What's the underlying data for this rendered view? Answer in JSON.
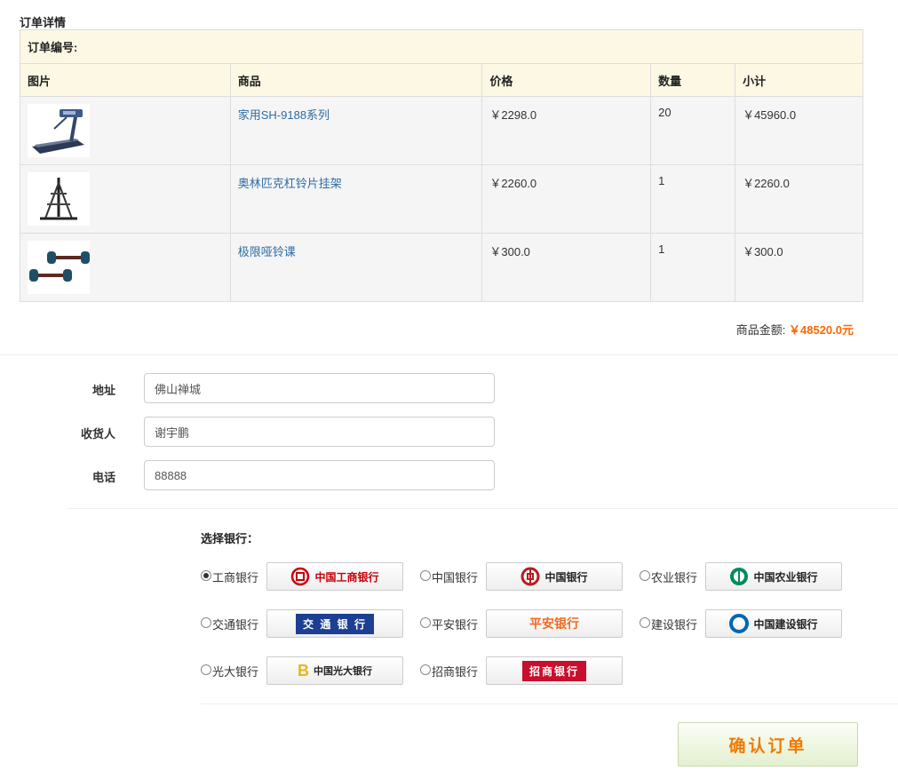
{
  "order": {
    "section_title": "订单详情",
    "order_no_label": "订单编号:",
    "columns": [
      "图片",
      "商品",
      "价格",
      "数量",
      "小计"
    ],
    "items": [
      {
        "name": "家用SH-9188系列",
        "price": "￥2298.0",
        "qty": "20",
        "subtotal": "￥45960.0",
        "image_icon": "treadmill-icon"
      },
      {
        "name": "奥林匹克杠铃片挂架",
        "price": "￥2260.0",
        "qty": "1",
        "subtotal": "￥2260.0",
        "image_icon": "plate-rack-icon"
      },
      {
        "name": "极限哑铃课",
        "price": "￥300.0",
        "qty": "1",
        "subtotal": "￥300.0",
        "image_icon": "dumbbell-icon"
      }
    ],
    "total_label": "商品金额:",
    "total_value": "￥48520.0元"
  },
  "form": {
    "address_label": "地址",
    "address_value": "佛山禅城",
    "receiver_label": "收货人",
    "receiver_value": "谢宇鹏",
    "phone_label": "电话",
    "phone_value": "88888"
  },
  "bank": {
    "title": "选择银行：",
    "options": [
      {
        "name": "工商银行",
        "logo_text": "中国工商银行",
        "color": "#c7000b",
        "selected": true
      },
      {
        "name": "中国银行",
        "logo_text": "中国银行",
        "color": "#b81c22",
        "selected": false
      },
      {
        "name": "农业银行",
        "logo_text": "中国农业银行",
        "color": "#008c5a",
        "selected": false
      },
      {
        "name": "交通银行",
        "logo_text": "交 通 银 行",
        "color": "#1c3f94",
        "selected": false
      },
      {
        "name": "平安银行",
        "logo_text": "平安银行",
        "color": "#f26b21",
        "selected": false
      },
      {
        "name": "建设银行",
        "logo_text": "中国建设银行",
        "color": "#0066b3",
        "selected": false
      },
      {
        "name": "光大银行",
        "logo_text": "中国光大银行",
        "color": "#e8b51b",
        "selected": false
      },
      {
        "name": "招商银行",
        "logo_text": "招商银行",
        "color": "#c8102e",
        "selected": false
      }
    ]
  },
  "confirm_label": "确认订单"
}
